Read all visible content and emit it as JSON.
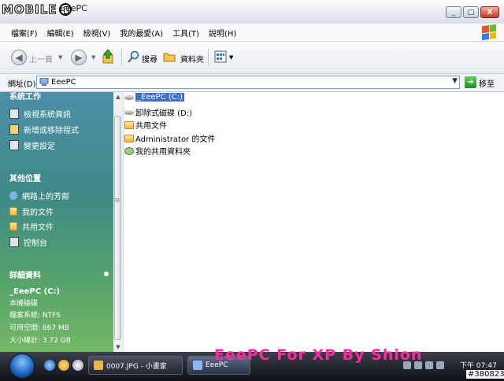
{
  "window": {
    "logo_text": "MOBILE",
    "title": "EeePC",
    "btn_min": "_",
    "btn_max": "□",
    "btn_close": "X"
  },
  "menu": [
    "檔案(F)",
    "編輯(E)",
    "檢視(V)",
    "我的最愛(A)",
    "工具(T)",
    "說明(H)"
  ],
  "toolbar": {
    "back_label": "上一頁",
    "search_label": "搜尋",
    "folders_label": "資料夾"
  },
  "address": {
    "label": "網址(D)",
    "value": "EeePC",
    "go_label": "移至"
  },
  "sidebar": {
    "tasks_header": "系統工作",
    "tasks": [
      "檢視系統資訊",
      "新增或移除程式",
      "變更設定"
    ],
    "places_header": "其他位置",
    "places": [
      "網路上的芳鄰",
      "我的文件",
      "共用文件",
      "控制台"
    ],
    "details_header": "詳細資料",
    "details": {
      "name": "_EeePC (C:)",
      "type": "本機磁碟",
      "filesystem": "檔案系統: NTFS",
      "free": "可用空間: 667 MB",
      "total": "大小總計: 3.72 GB"
    }
  },
  "files": [
    {
      "name": "_EeePC (C:)",
      "icon": "drive-icon",
      "selected": true
    },
    {
      "name": "卸除式磁碟 (D:)",
      "icon": "removable-drive-icon",
      "selected": false
    },
    {
      "name": "共用文件",
      "icon": "folder-icon",
      "selected": false
    },
    {
      "name": "Administrator 的文件",
      "icon": "folder-icon",
      "selected": false
    },
    {
      "name": "我的共用資料夾",
      "icon": "shared-folder-icon",
      "selected": false
    }
  ],
  "taskbar": {
    "tasks": [
      "0007.JPG - 小畫家",
      "EeePC"
    ],
    "watermark": "EeePC For XP By Shion",
    "clock": "下午 07:47"
  },
  "serial": "#380823",
  "colors": {
    "selection": "#3d6fd1",
    "watermark": "#ff2aa0",
    "sidebar_top": "#4c8fa6",
    "sidebar_bottom": "#74b866"
  }
}
